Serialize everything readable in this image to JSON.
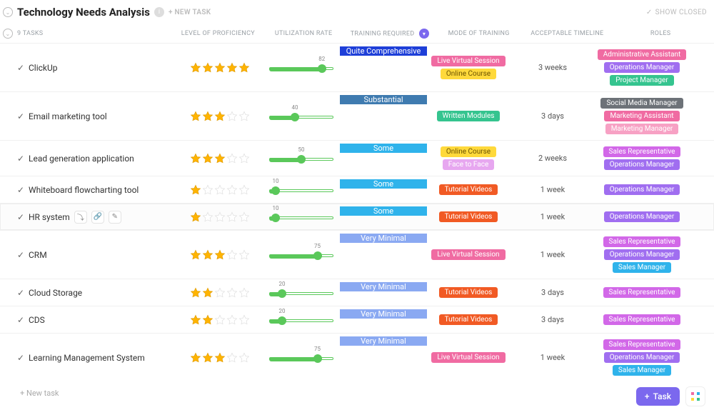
{
  "header": {
    "title": "Technology Needs Analysis",
    "new_task_label": "+ NEW TASK",
    "show_closed": "SHOW CLOSED"
  },
  "columns": {
    "task_count": "9 TASKS",
    "proficiency": "LEVEL OF PROFICIENCY",
    "utilization": "UTILIZATION RATE",
    "training": "TRAINING REQUIRED",
    "mode": "MODE OF TRAINING",
    "timeline": "ACCEPTABLE TIMELINE",
    "roles": "ROLES"
  },
  "training_levels": {
    "quite_comprehensive": {
      "label": "Quite Comprehensive",
      "color": "#1e3fd8"
    },
    "substantial": {
      "label": "Substantial",
      "color": "#3f7bb0"
    },
    "some": {
      "label": "Some",
      "color": "#2fb3eb"
    },
    "very_minimal": {
      "label": "Very Minimal",
      "color": "#8aa9f2"
    }
  },
  "chip_colors": {
    "live_virtual": {
      "label": "Live Virtual Session",
      "bg": "#f06ba2"
    },
    "online_course": {
      "label": "Online Course",
      "bg": "#ffd93b",
      "fg": "#6a5200"
    },
    "written_modules": {
      "label": "Written Modules",
      "bg": "#35c48f"
    },
    "face_to_face": {
      "label": "Face to Face",
      "bg": "#e7a7f0"
    },
    "tutorial_videos": {
      "label": "Tutorial Videos",
      "bg": "#f15a24"
    },
    "admin_assistant": {
      "label": "Administrative Assistant",
      "bg": "#f06ba2"
    },
    "ops_manager": {
      "label": "Operations Manager",
      "bg": "#a06ef0"
    },
    "project_manager": {
      "label": "Project Manager",
      "bg": "#35c48f"
    },
    "social_media": {
      "label": "Social Media Manager",
      "bg": "#6d7278"
    },
    "marketing_asst": {
      "label": "Marketing Assistant",
      "bg": "#f06ba2"
    },
    "marketing_mgr": {
      "label": "Marketing Manager",
      "bg": "#f7a1c4"
    },
    "sales_rep": {
      "label": "Sales Representative",
      "bg": "#d268e8"
    },
    "sales_manager": {
      "label": "Sales Manager",
      "bg": "#2fb3eb"
    }
  },
  "tasks": [
    {
      "name": "ClickUp",
      "stars": 5,
      "util": 82,
      "training": "quite_comprehensive",
      "modes": [
        "live_virtual",
        "online_course"
      ],
      "timeline": "3 weeks",
      "roles": [
        "admin_assistant",
        "ops_manager",
        "project_manager"
      ]
    },
    {
      "name": "Email marketing tool",
      "stars": 3,
      "util": 40,
      "training": "substantial",
      "modes": [
        "written_modules"
      ],
      "timeline": "3 days",
      "roles": [
        "social_media",
        "marketing_asst",
        "marketing_mgr"
      ]
    },
    {
      "name": "Lead generation application",
      "stars": 3,
      "util": 50,
      "training": "some",
      "modes": [
        "online_course",
        "face_to_face"
      ],
      "timeline": "2 weeks",
      "roles": [
        "sales_rep",
        "ops_manager"
      ]
    },
    {
      "name": "Whiteboard flowcharting tool",
      "stars": 1,
      "util": 10,
      "training": "some",
      "modes": [
        "tutorial_videos"
      ],
      "timeline": "1 week",
      "roles": [
        "ops_manager"
      ]
    },
    {
      "name": "HR system",
      "stars": 1,
      "util": 10,
      "training": "some",
      "modes": [
        "tutorial_videos"
      ],
      "timeline": "1 week",
      "roles": [
        "ops_manager"
      ],
      "focused": true
    },
    {
      "name": "CRM",
      "stars": 3,
      "util": 75,
      "training": "very_minimal",
      "modes": [
        "live_virtual"
      ],
      "timeline": "1 week",
      "roles": [
        "sales_rep",
        "ops_manager",
        "sales_manager"
      ]
    },
    {
      "name": "Cloud Storage",
      "stars": 2,
      "util": 20,
      "training": "very_minimal",
      "modes": [
        "tutorial_videos"
      ],
      "timeline": "3 days",
      "roles": [
        "sales_rep"
      ]
    },
    {
      "name": "CDS",
      "stars": 2,
      "util": 20,
      "training": "very_minimal",
      "modes": [
        "tutorial_videos"
      ],
      "timeline": "3 days",
      "roles": [
        "sales_rep"
      ]
    },
    {
      "name": "Learning Management System",
      "stars": 3,
      "util": 75,
      "training": "very_minimal",
      "modes": [
        "live_virtual"
      ],
      "timeline": "1 week",
      "roles": [
        "sales_rep",
        "ops_manager",
        "sales_manager"
      ]
    }
  ],
  "footer": {
    "new_task": "+ New task",
    "task_button": "Task"
  }
}
